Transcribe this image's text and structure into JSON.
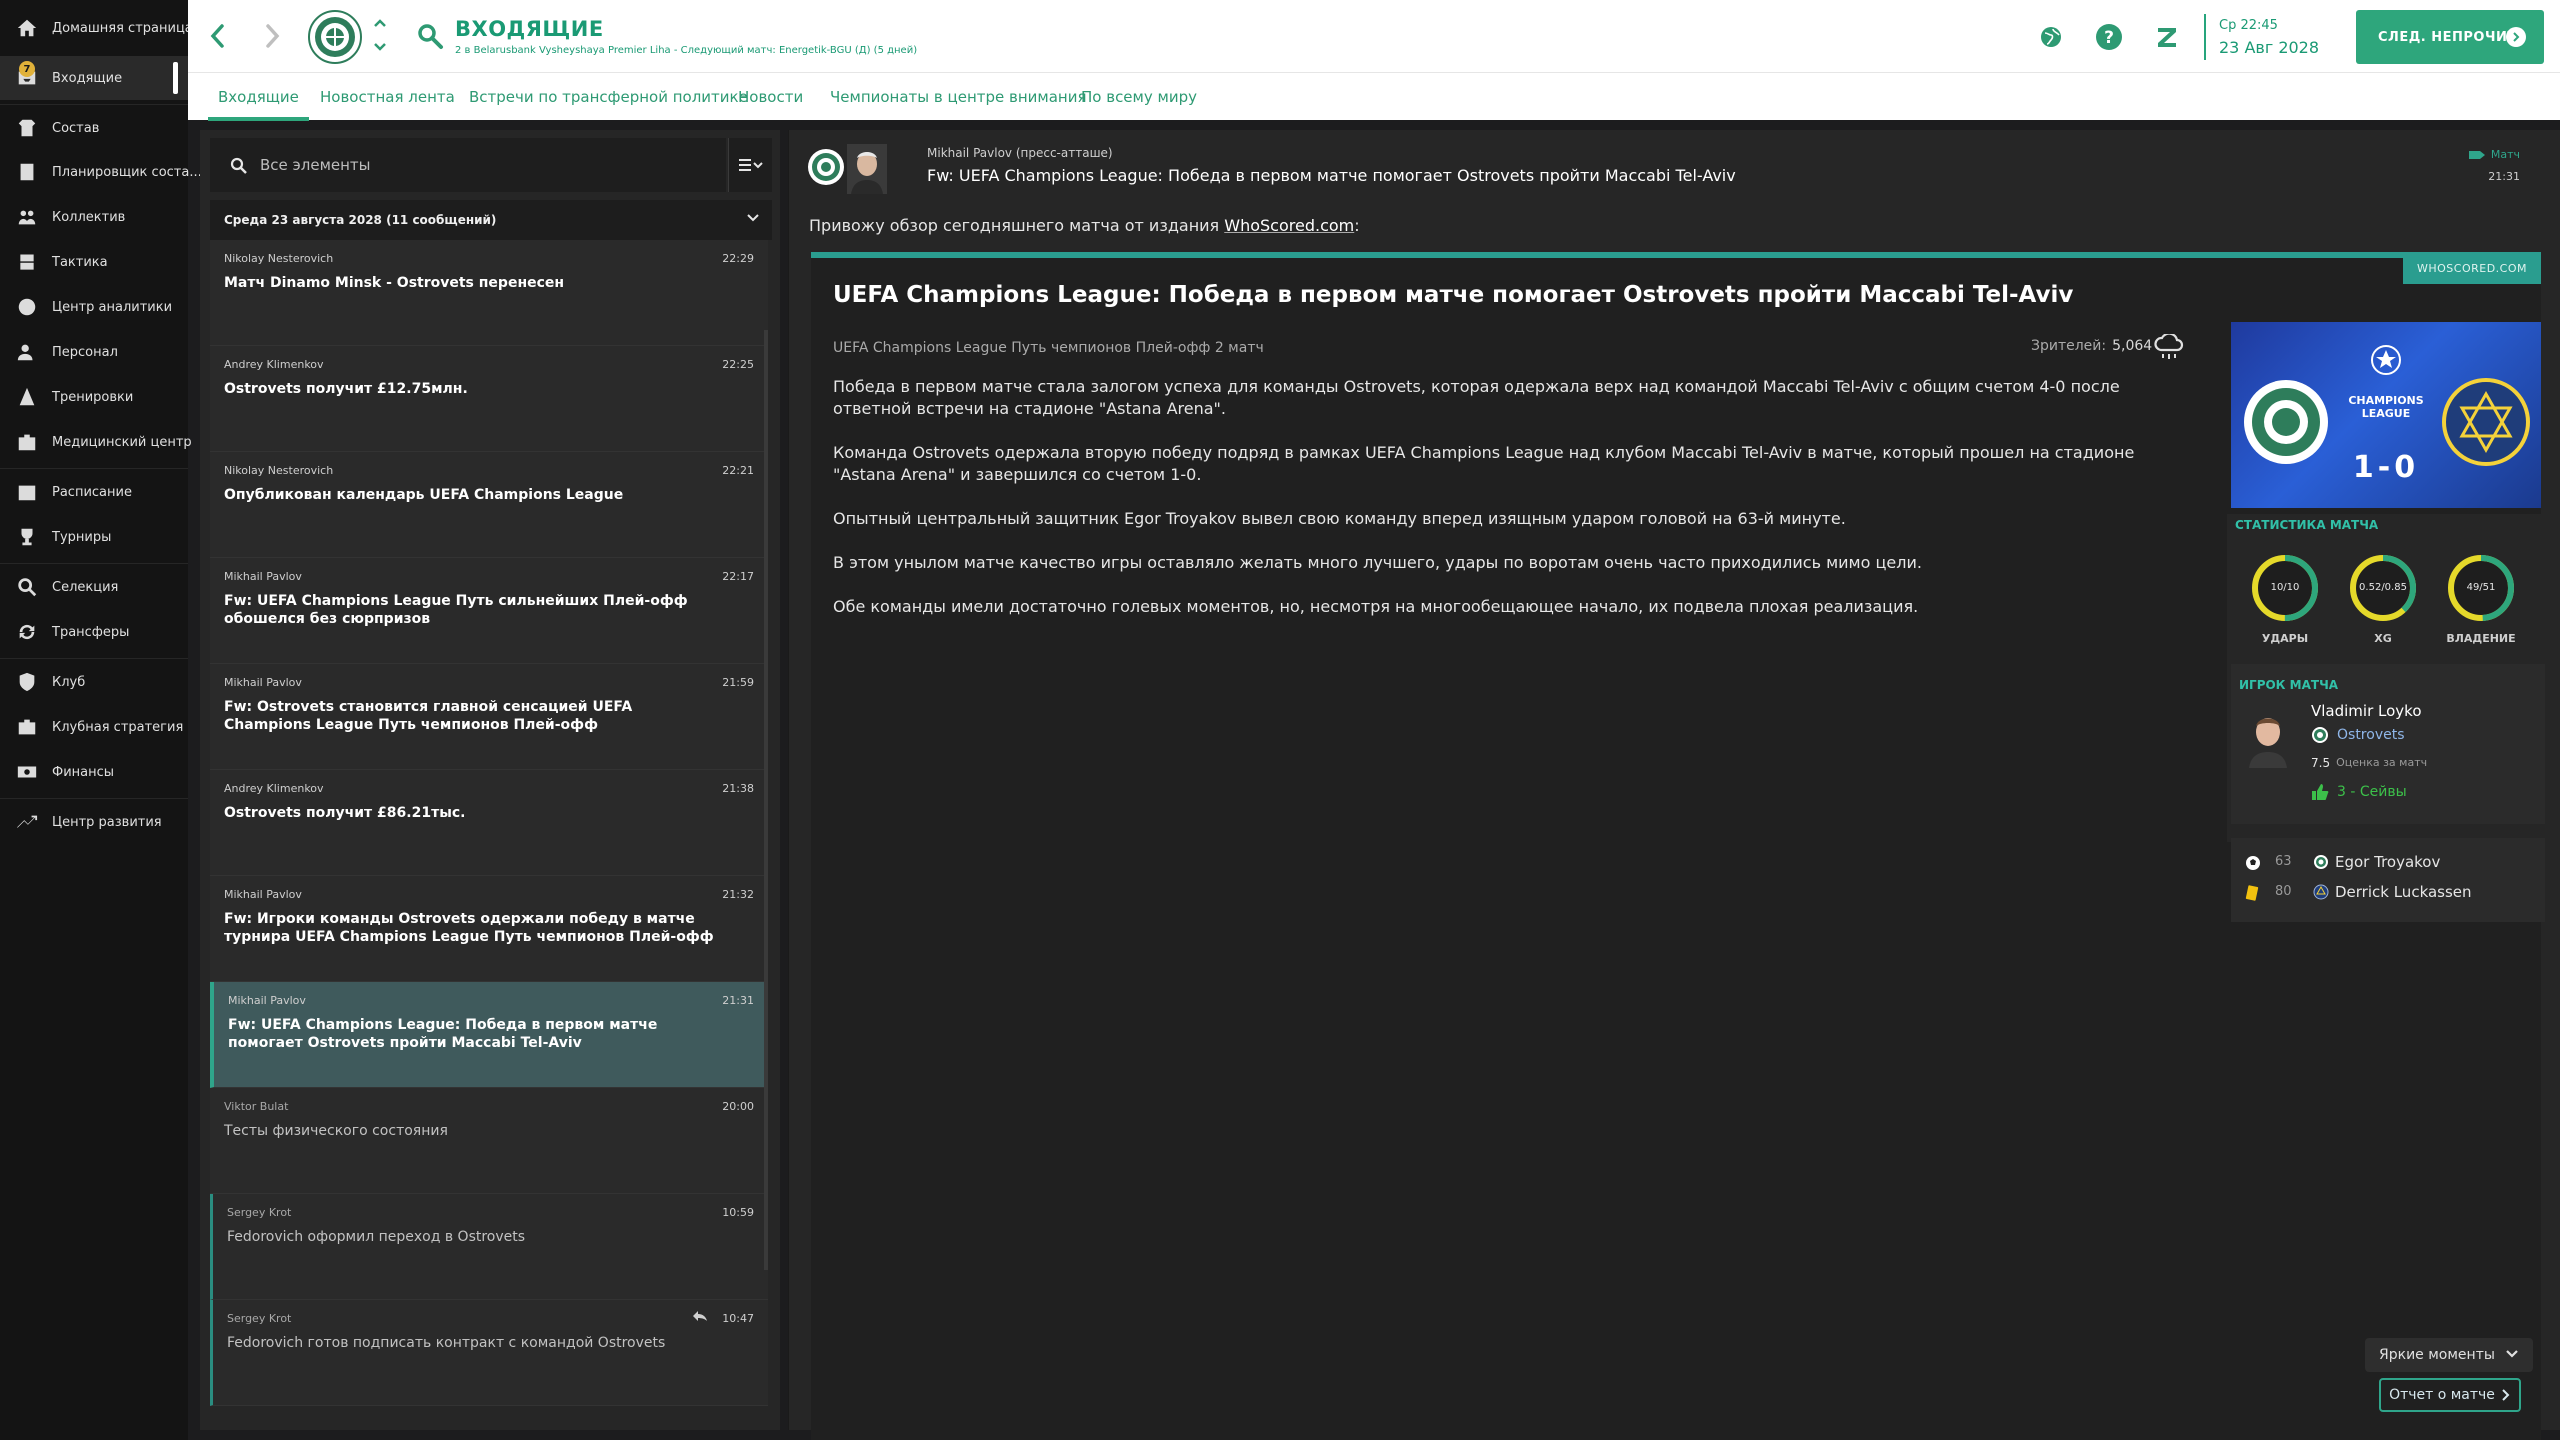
{
  "sidebar": {
    "items": [
      {
        "label": "Домашняя страница",
        "icon": "home-icon"
      },
      {
        "label": "Входящие",
        "icon": "inbox-icon",
        "badge": "7"
      },
      {
        "label": "Состав",
        "icon": "squad-icon"
      },
      {
        "label": "Планировщик соста...",
        "icon": "planner-icon"
      },
      {
        "label": "Коллектив",
        "icon": "dynamics-icon"
      },
      {
        "label": "Тактика",
        "icon": "tactics-icon"
      },
      {
        "label": "Центр аналитики",
        "icon": "analytics-icon"
      },
      {
        "label": "Персонал",
        "icon": "staff-icon"
      },
      {
        "label": "Тренировки",
        "icon": "training-icon"
      },
      {
        "label": "Медицинский центр",
        "icon": "medical-icon"
      },
      {
        "label": "Расписание",
        "icon": "calendar-icon"
      },
      {
        "label": "Турниры",
        "icon": "trophy-icon"
      },
      {
        "label": "Селекция",
        "icon": "scouting-icon"
      },
      {
        "label": "Трансферы",
        "icon": "transfers-icon"
      },
      {
        "label": "Клуб",
        "icon": "club-icon"
      },
      {
        "label": "Клубная стратегия",
        "icon": "strategy-icon"
      },
      {
        "label": "Финансы",
        "icon": "finances-icon"
      },
      {
        "label": "Центр развития",
        "icon": "development-icon"
      }
    ]
  },
  "header": {
    "title": "ВХОДЯЩИЕ",
    "subtitle": "2 в Belarusbank Vysheyshaya Premier Liha - Следующий матч: Energetik-BGU (Д) (5 дней)",
    "time": "Ср 22:45",
    "date": "23 Авг 2028",
    "next_unread_label": "СЛЕД. НЕПРОЧИТ."
  },
  "tabs": [
    "Входящие",
    "Новостная лента",
    "Встречи по трансферной политике",
    "Новости",
    "Чемпионаты в центре внимания",
    "По всему миру"
  ],
  "search": {
    "placeholder": "Все элементы"
  },
  "list": {
    "day_header": "Среда 23 августа 2028 (11 сообщений)",
    "messages": [
      {
        "sender": "Nikolay Nesterovich",
        "time": "22:29",
        "subject": "Матч Dinamo Minsk - Ostrovets перенесен"
      },
      {
        "sender": "Andrey Klimenkov",
        "time": "22:25",
        "subject": "Ostrovets получит £12.75млн."
      },
      {
        "sender": "Nikolay Nesterovich",
        "time": "22:21",
        "subject": "Опубликован календарь UEFA Champions League"
      },
      {
        "sender": "Mikhail Pavlov",
        "time": "22:17",
        "subject": "Fw: UEFA Champions League Путь сильнейших Плей-офф обошелся без сюрпризов"
      },
      {
        "sender": "Mikhail Pavlov",
        "time": "21:59",
        "subject": "Fw: Ostrovets становится главной сенсацией UEFA Champions League Путь чемпионов Плей-офф"
      },
      {
        "sender": "Andrey Klimenkov",
        "time": "21:38",
        "subject": "Ostrovets получит £86.21тыс."
      },
      {
        "sender": "Mikhail Pavlov",
        "time": "21:32",
        "subject": "Fw: Игроки команды Ostrovets одержали победу в матче турнира UEFA Champions League Путь чемпионов Плей-офф"
      },
      {
        "sender": "Mikhail Pavlov",
        "time": "21:31",
        "subject": "Fw: UEFA Champions League: Победа в первом матче помогает Ostrovets пройти Maccabi Tel-Aviv"
      },
      {
        "sender": "Viktor Bulat",
        "time": "20:00",
        "subject": "Тесты физического состояния"
      },
      {
        "sender": "Sergey Krot",
        "time": "10:59",
        "subject": "Fedorovich оформил переход в Ostrovets"
      },
      {
        "sender": "Sergey Krot",
        "time": "10:47",
        "subject": "Fedorovich готов подписать контракт с командой Ostrovets"
      }
    ]
  },
  "message": {
    "from_name": "Mikhail Pavlov  (пресс-атташе)",
    "subject": "Fw: UEFA Champions League: Победа в первом матче помогает Ostrovets пройти Maccabi Tel-Aviv",
    "tag": "Матч",
    "time": "21:31",
    "intro_prefix": "Привожу обзор сегодняшнего матча от издания ",
    "intro_link": "WhoScored.com",
    "intro_suffix": ":",
    "source_tag": "WHOSCORED.COM",
    "article_title": "UEFA Champions League: Победа в первом матче помогает Ostrovets пройти Maccabi Tel-Aviv",
    "meta": "UEFA Champions League Путь чемпионов Плей-офф 2 матч",
    "attendance_label": "Зрителей:",
    "attendance": "5,064",
    "paragraphs": [
      "Победа в первом матче стала залогом успеха для команды Ostrovets, которая одержала верх над командой Maccabi Tel-Aviv с общим счетом 4-0 после ответной встречи на стадионе \"Astana Arena\".",
      "Команда Ostrovets одержала вторую победу подряд в рамках UEFA Champions League над клубом Maccabi Tel-Aviv в матче, который прошел на стадионе \"Astana Arena\" и завершился со счетом 1-0.",
      "Опытный центральный защитник Egor Troyakov вывел свою команду вперед изящным ударом головой на 63-й минуте.",
      "В этом унылом матче качество игры оставляло желать много лучшего, удары по воротам очень часто приходились мимо цели.",
      "Обе команды имели достаточно голевых моментов, но, несмотря на многообещающее начало, их подвела плохая реализация."
    ],
    "banner": {
      "score": "1-0",
      "competition": "CHAMPIONS LEAGUE"
    },
    "stats": {
      "heading": "СТАТИСТИКА МАТЧА",
      "items": [
        {
          "value": "10/10",
          "label": "УДАРЫ",
          "share_home": 0.5
        },
        {
          "value": "0.52/0.85",
          "label": "XG",
          "share_home": 0.38
        },
        {
          "value": "49/51",
          "label": "ВЛАДЕНИЕ",
          "share_home": 0.49
        }
      ]
    },
    "potm": {
      "heading": "ИГРОК МАТЧА",
      "name": "Vladimir Loyko",
      "club": "Ostrovets",
      "rating": "7.5",
      "rating_label": "Оценка за матч",
      "stat": "3 - Сейвы"
    },
    "events": [
      {
        "minute": "63",
        "player": "Egor Troyakov",
        "type": "goal"
      },
      {
        "minute": "80",
        "player": "Derrick Luckassen",
        "type": "yellow-card"
      }
    ],
    "highlights_label": "Яркие моменты",
    "report_label": "Отчет о матче"
  },
  "colors": {
    "accent": "#2ea67c",
    "teal": "#2a9d8f",
    "gauge_home": "#2ea67c",
    "gauge_away": "#e5d92a"
  }
}
